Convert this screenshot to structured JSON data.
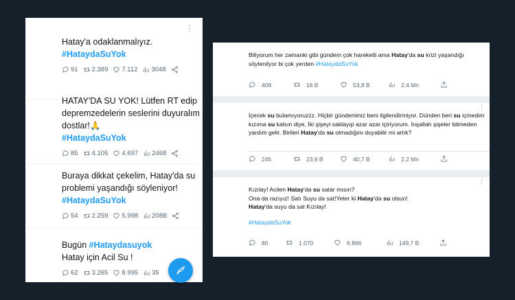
{
  "left_feed": [
    {
      "text": "Hatay'a odaklanmalıyız.",
      "hashtag": "#HataydaSuYok",
      "replies": "91",
      "retweets": "2.389",
      "likes": "7.112",
      "views": "3048"
    },
    {
      "text": "HATAY'DA SU YOK! Lütfen RT edip depremzedelerin seslerini duyuralım dostlar!🙏",
      "hashtag": "#HataydaSuYok",
      "replies": "85",
      "retweets": "4.105",
      "likes": "4.697",
      "views": "2468"
    },
    {
      "text": "Buraya dikkat çekelim, Hatay'da su problemi yaşandığı söyleniyor!",
      "hashtag": "#HataydaSuYok",
      "replies": "54",
      "retweets": "2.259",
      "likes": "5.998",
      "views": "208B"
    },
    {
      "prefix": "Bugün ",
      "hashtag": "#Hataydasuyok",
      "text": "Hatay için Acil Su !",
      "replies": "62",
      "retweets": "3.265",
      "likes": "8.995",
      "views": "35"
    }
  ],
  "right_feed": [
    {
      "p1": "Biliyorum her zamanki gibi gündem çok hareketli ama ",
      "b1": "Hatay",
      "p2": "'da ",
      "b2": "su",
      "p3": " krizi yaşandığı söylenilyor bi çok yerden ",
      "hashtag": "#HataydaSuYok",
      "replies": "409",
      "retweets": "16 B",
      "likes": "53,8 B",
      "views": "2,4 Mn"
    },
    {
      "p1": "İçecek ",
      "b1": "su",
      "p2": " bulamıyoruzzz. Hiçbir gündeminiz beni ilgilendirmiyor. Dünden beri ",
      "b2": "su",
      "p3": " içmedim kızıma ",
      "b3": "su",
      "p4": " kalsın diye, İki şişeyi saklayıp azar azar içiriyorum. İnşallah şişeler bitmeden yardım gelir. Birileri ",
      "b4": "Hatay",
      "p5": "'da ",
      "b5": "su",
      "p6": " olmadığını duyabilir mi artık?",
      "replies": "245",
      "retweets": "23,9 B",
      "likes": "40,7 B",
      "views": "2,2 Mn"
    },
    {
      "l1a": "Kızılay! Acilen ",
      "l1b": "Hatay",
      "l1c": "'da ",
      "l1d": "su",
      "l1e": " satar mısın?",
      "l2a": "Ona da razıyız! Satı Suyu da sat!Yeter ki ",
      "l2b": "Hatay",
      "l2c": "'da ",
      "l2d": "su",
      "l2e": " olsun!",
      "l3a": "Hatay",
      "l3b": "'da suyu da sat Kızılay!",
      "hashtag": "#HataydaSuYok",
      "replies": "80",
      "retweets": "1.070",
      "likes": "6.866",
      "views": "149,7 B"
    }
  ],
  "icons": [
    "reply-icon",
    "retweet-icon",
    "like-icon",
    "views-icon",
    "share-icon",
    "more-icon",
    "compose-icon"
  ],
  "colors": {
    "background": "#15202b",
    "accent": "#1d9bf0",
    "text": "#0f1419",
    "muted": "#536471"
  }
}
